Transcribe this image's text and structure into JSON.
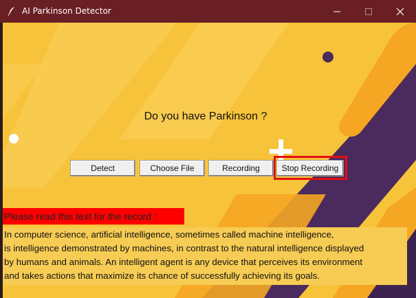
{
  "window": {
    "title": "AI Parkinson Detector",
    "controls": {
      "minimize": "—",
      "maximize": "☐",
      "close": "✕"
    }
  },
  "main": {
    "question": "Do you have Parkinson ?",
    "buttons": {
      "detect": "Detect",
      "choose_file": "Choose File",
      "recording": "Recording",
      "stop_recording": "Stop Recording"
    },
    "notice": "Please read this text for the record :",
    "paragraph_lines": [
      "In computer science, artificial intelligence, sometimes called machine intelligence,",
      "is intelligence demonstrated by machines, in contrast to the natural intelligence displayed",
      "by humans and animals. An intelligent agent is any device that perceives its environment",
      "and takes actions that maximize its chance of successfully achieving its goals."
    ]
  },
  "colors": {
    "titlebar": "#6a1f24",
    "background": "#f7c33a",
    "accent_purple": "#4b2a5e",
    "highlight_red": "#e01010",
    "notice_red": "#ff0000"
  }
}
